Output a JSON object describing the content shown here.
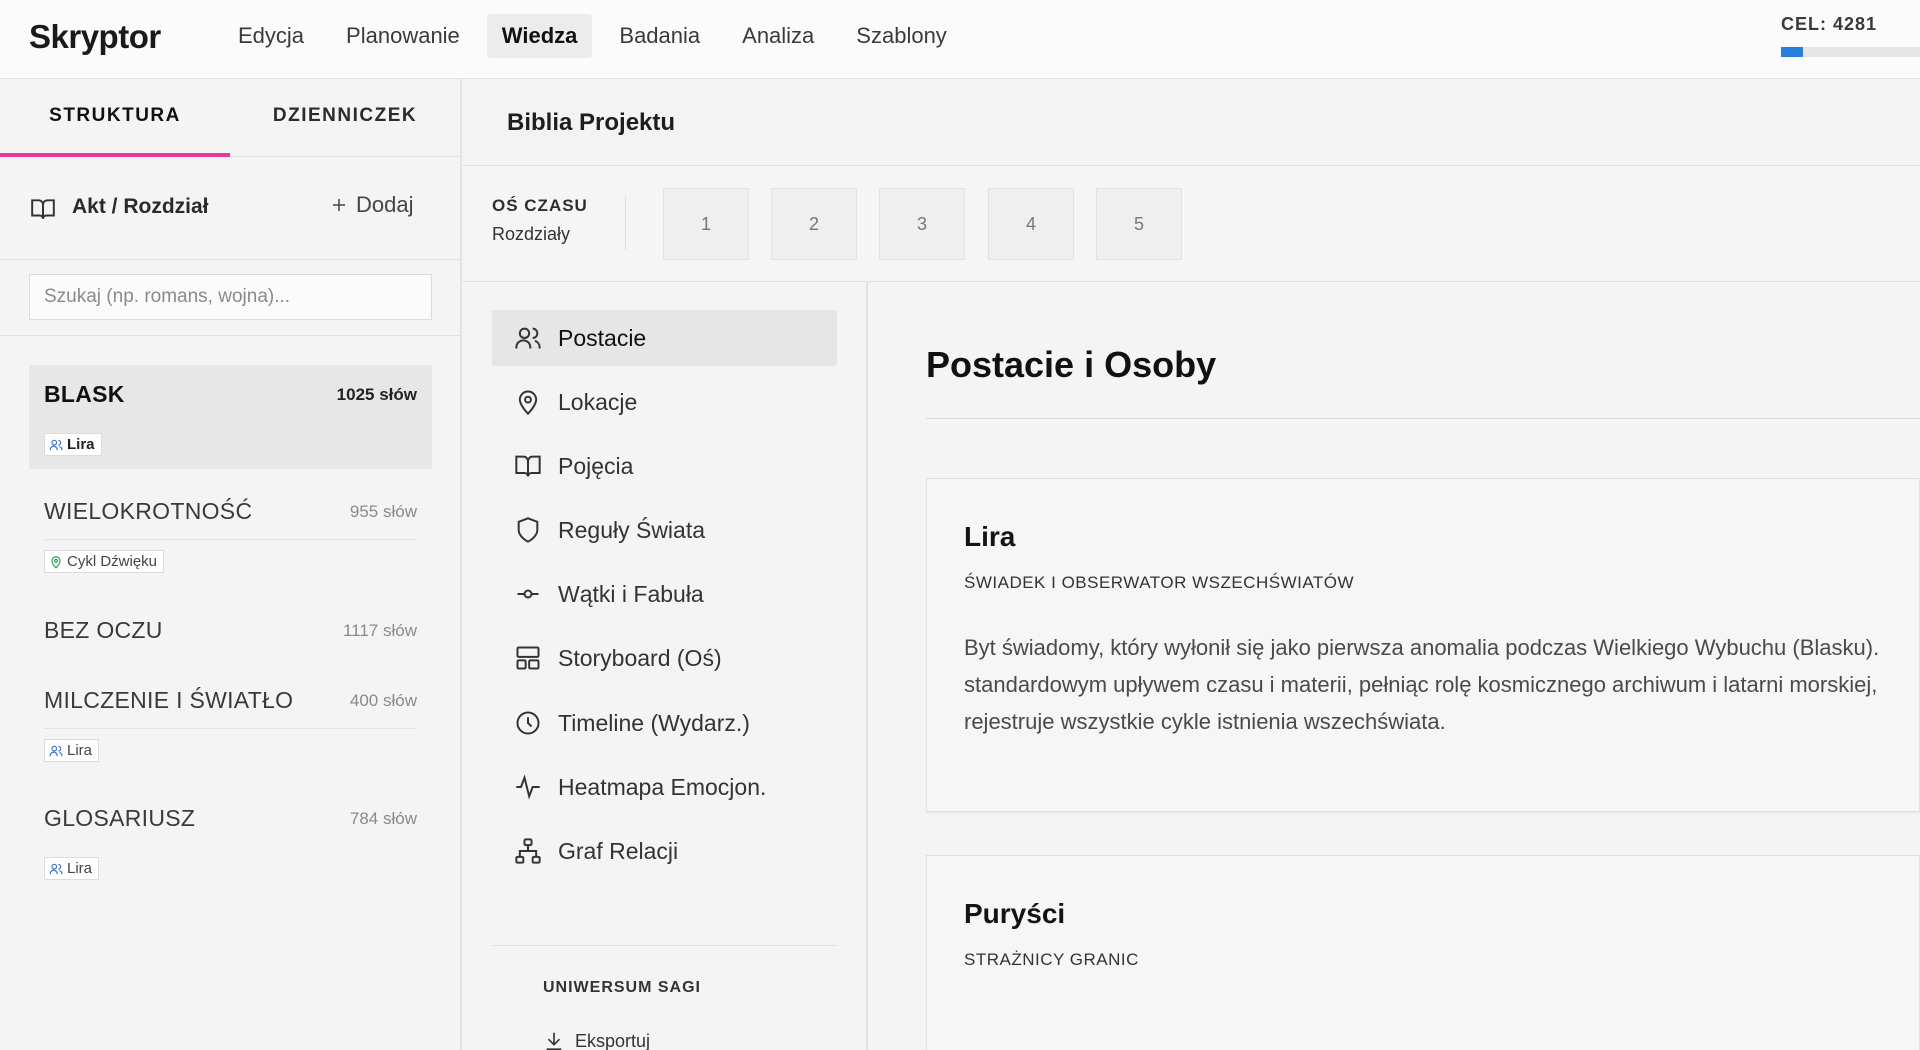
{
  "app": {
    "name": "Skryptor"
  },
  "nav": [
    {
      "label": "Edycja"
    },
    {
      "label": "Planowanie"
    },
    {
      "label": "Wiedza"
    },
    {
      "label": "Badania"
    },
    {
      "label": "Analiza"
    },
    {
      "label": "Szablony"
    }
  ],
  "goal": {
    "label": "CEL: 4281",
    "progress": 0.16
  },
  "sidebar": {
    "tabs": [
      {
        "label": "STRUKTURA"
      },
      {
        "label": "DZIENNICZEK"
      }
    ],
    "header_label": "Akt / Rozdział",
    "add_label": "Dodaj",
    "search_placeholder": "Szukaj (np. romans, wojna)...",
    "chapters": [
      {
        "title": "BLASK",
        "words": "1025 słów",
        "tag": "Lira",
        "tag_icon": "users-icon"
      },
      {
        "title": "WIELOKROTNOŚĆ",
        "words": "955 słów",
        "tag": "Cykl Dźwięku",
        "tag_icon": "map-pin-icon"
      },
      {
        "title": "BEZ OCZU",
        "words": "1117 słów"
      },
      {
        "title": "MILCZENIE I ŚWIATŁO",
        "words": "400 słów",
        "tag": "Lira",
        "tag_icon": "users-icon"
      },
      {
        "title": "GLOSARIUSZ",
        "words": "784 słów",
        "tag": "Lira",
        "tag_icon": "users-icon"
      }
    ]
  },
  "main": {
    "title": "Biblia Projektu",
    "timeline": {
      "label": "OŚ CZASU",
      "sub": "Rozdziały",
      "boxes": [
        "1",
        "2",
        "3",
        "4",
        "5"
      ]
    }
  },
  "knowledge_nav": {
    "items": [
      {
        "label": "Postacie",
        "icon": "users-icon"
      },
      {
        "label": "Lokacje",
        "icon": "map-pin-icon"
      },
      {
        "label": "Pojęcia",
        "icon": "book-icon"
      },
      {
        "label": "Reguły Świata",
        "icon": "shield-icon"
      },
      {
        "label": "Wątki i Fabuła",
        "icon": "commit-icon"
      },
      {
        "label": "Storyboard (Oś)",
        "icon": "layout-icon"
      },
      {
        "label": "Timeline (Wydarz.)",
        "icon": "clock-icon"
      },
      {
        "label": "Heatmapa Emocjon.",
        "icon": "activity-icon"
      },
      {
        "label": "Graf Relacji",
        "icon": "network-icon"
      }
    ],
    "section": "UNIWERSUM SAGI",
    "export_label": "Eksportuj"
  },
  "content": {
    "title": "Postacie i Osoby",
    "cards": [
      {
        "name": "Lira",
        "role": "ŚWIADEK I OBSERWATOR WSZECHŚWIATÓW",
        "lines": [
          "Byt świadomy, który wyłonił się jako pierwsza anomalia podczas Wielkiego Wybuchu (Blasku).",
          "standardowym upływem czasu i materii, pełniąc rolę kosmicznego archiwum i latarni morskiej,",
          "rejestruje wszystkie cykle istnienia wszechświata."
        ]
      },
      {
        "name": "Puryści",
        "role": "STRAŻNICY GRANIC"
      }
    ]
  },
  "colors": {
    "accent": "#e8398f",
    "progress": "#2a7fdc",
    "location": "#2e9e57",
    "users": "#3b6fd0"
  }
}
